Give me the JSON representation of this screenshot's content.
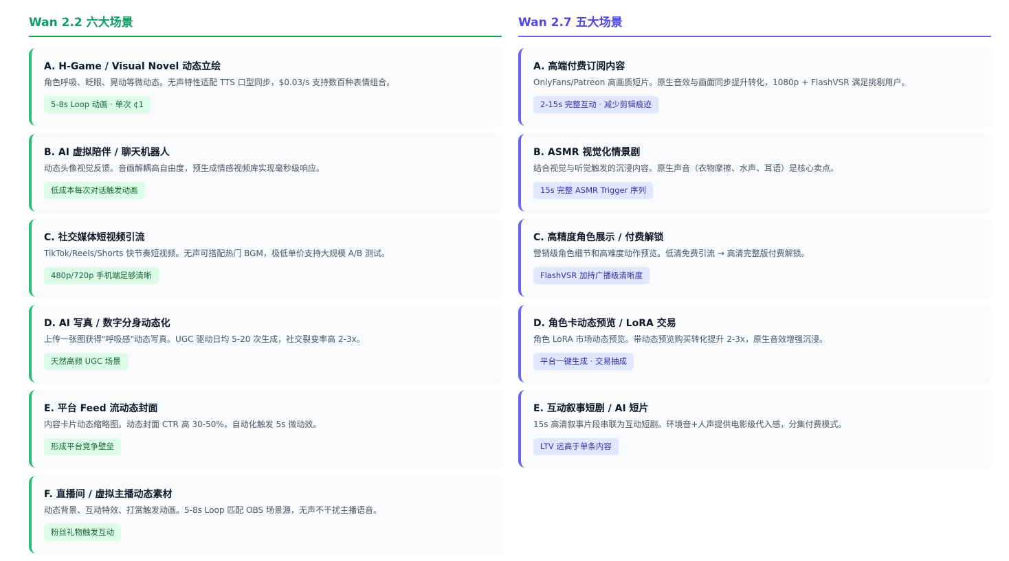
{
  "left": {
    "title": "Wan 2.2 六大场景",
    "accent_color": "#16a34a",
    "cards": [
      {
        "title": "A. H-Game / Visual Novel 动态立绘",
        "desc": "角色呼吸、眨眼、晃动等微动态。无声特性适配 TTS 口型同步，$0.03/s 支持数百种表情组合。",
        "tag": "5-8s Loop 动画 · 单次 ¢1"
      },
      {
        "title": "B. AI 虚拟陪伴 / 聊天机器人",
        "desc": "动态头像视觉反馈。音画解耦高自由度，预生成情感视频库实现毫秒级响应。",
        "tag": "低成本每次对话触发动画"
      },
      {
        "title": "C. 社交媒体短视频引流",
        "desc": "TikTok/Reels/Shorts 快节奏短视频。无声可搭配热门 BGM，极低单价支持大规模 A/B 测试。",
        "tag": "480p/720p 手机端足够清晰"
      },
      {
        "title": "D. AI 写真 / 数字分身动态化",
        "desc": "上传一张图获得\"呼吸感\"动态写真。UGC 驱动日均 5-20 次生成，社交裂变率高 2-3x。",
        "tag": "天然高频 UGC 场景"
      },
      {
        "title": "E. 平台 Feed 流动态封面",
        "desc": "内容卡片动态缩略图。动态封面 CTR 高 30-50%，自动化触发 5s 微动效。",
        "tag": "形成平台竞争壁垒"
      },
      {
        "title": "F. 直播间 / 虚拟主播动态素材",
        "desc": "动态背景、互动特效、打赏触发动画。5-8s Loop 匹配 OBS 场景源，无声不干扰主播语音。",
        "tag": "粉丝礼物触发互动"
      }
    ]
  },
  "right": {
    "title": "Wan 2.7 五大场景",
    "accent_color": "#4f46e5",
    "cards": [
      {
        "title": "A. 高端付费订阅内容",
        "desc": "OnlyFans/Patreon 高画质短片。原生音效与画面同步提升转化，1080p + FlashVSR 满足挑剔用户。",
        "tag": "2-15s 完整互动 · 减少剪辑痕迹"
      },
      {
        "title": "B. ASMR 视觉化情景剧",
        "desc": "结合视觉与听觉触发的沉浸内容。原生声音（衣物摩擦、水声、耳语）是核心卖点。",
        "tag": "15s 完整 ASMR Trigger 序列"
      },
      {
        "title": "C. 高精度角色展示 / 付费解锁",
        "desc": "营销级角色细节和高难度动作预览。低清免费引流 → 高清完整版付费解锁。",
        "tag": "FlashVSR 加持广播级清晰度"
      },
      {
        "title": "D. 角色卡动态预览 / LoRA 交易",
        "desc": "角色 LoRA 市场动态预览。带动态预览购买转化提升 2-3x，原生音效增强沉浸。",
        "tag": "平台一键生成 · 交易抽成"
      },
      {
        "title": "E. 互动叙事短剧 / AI 短片",
        "desc": "15s 高清叙事片段串联为互动短剧。环境音+人声提供电影级代入感，分集付费模式。",
        "tag": "LTV 远高于单条内容"
      }
    ]
  }
}
